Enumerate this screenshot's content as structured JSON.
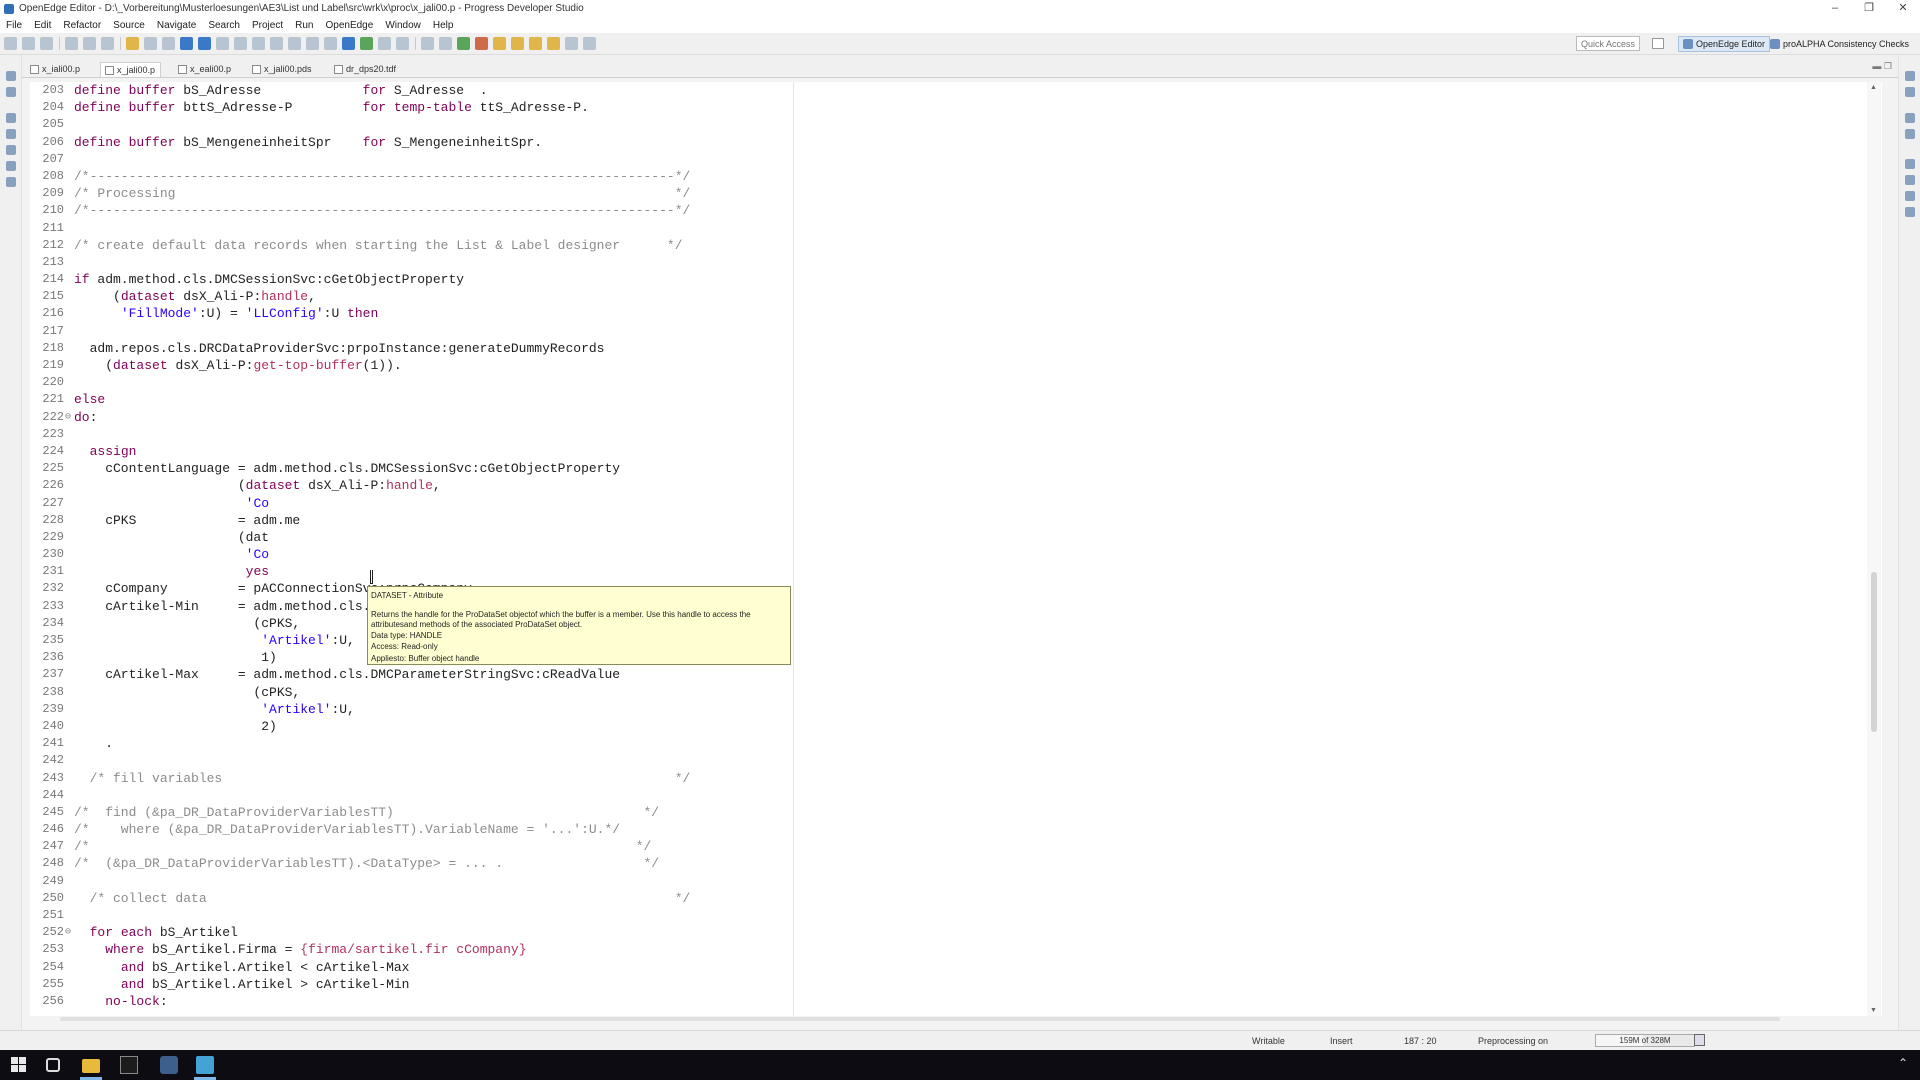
{
  "window": {
    "title": "OpenEdge Editor - D:\\_Vorbereitung\\Musterloesungen\\AE3\\List und Label\\src\\wrk\\x\\proc\\x_jali00.p - Progress Developer Studio",
    "controls": [
      "–",
      "❐",
      "✕"
    ]
  },
  "menu": [
    "File",
    "Edit",
    "Refactor",
    "Source",
    "Navigate",
    "Search",
    "Project",
    "Run",
    "OpenEdge",
    "Window",
    "Help"
  ],
  "toolbar": {
    "quick_access_placeholder": "Quick Access",
    "perspectives": [
      "OpenEdge Editor",
      "proALPHA Consistency Checks"
    ]
  },
  "tabs": [
    {
      "label": "x_iali00.p"
    },
    {
      "label": "x_jali00.p",
      "active": true
    },
    {
      "label": "x_eali00.p"
    },
    {
      "label": "x_jali00.pds"
    },
    {
      "label": "dr_dps20.tdf"
    }
  ],
  "code": [
    {
      "n": "203",
      "t": [
        [
          "kw",
          "define buffer "
        ],
        [
          "pl",
          "bS_Adresse             "
        ],
        [
          "kw",
          "for "
        ],
        [
          "pl",
          "S_Adresse  ."
        ]
      ]
    },
    {
      "n": "204",
      "t": [
        [
          "kw",
          "define buffer "
        ],
        [
          "pl",
          "bttS_Adresse-P         "
        ],
        [
          "kw",
          "for temp-table "
        ],
        [
          "pl",
          "ttS_Adresse-P."
        ]
      ]
    },
    {
      "n": "205",
      "t": [
        [
          "pl",
          ""
        ]
      ]
    },
    {
      "n": "206",
      "t": [
        [
          "kw",
          "define buffer "
        ],
        [
          "pl",
          "bS_MengeneinheitSpr    "
        ],
        [
          "kw",
          "for "
        ],
        [
          "pl",
          "S_MengeneinheitSpr."
        ]
      ]
    },
    {
      "n": "207",
      "t": [
        [
          "pl",
          ""
        ]
      ]
    },
    {
      "n": "208",
      "t": [
        [
          "cm",
          "/*---------------------------------------------------------------------------*/"
        ]
      ]
    },
    {
      "n": "209",
      "t": [
        [
          "cm",
          "/* Processing                                                                */"
        ]
      ]
    },
    {
      "n": "210",
      "t": [
        [
          "cm",
          "/*---------------------------------------------------------------------------*/"
        ]
      ]
    },
    {
      "n": "211",
      "t": [
        [
          "pl",
          ""
        ]
      ]
    },
    {
      "n": "212",
      "t": [
        [
          "cm",
          "/* create default data records when starting the List & Label designer      */"
        ]
      ]
    },
    {
      "n": "213",
      "t": [
        [
          "pl",
          ""
        ]
      ]
    },
    {
      "n": "214",
      "t": [
        [
          "kw",
          "if "
        ],
        [
          "pl",
          "adm.method.cls.DMCSessionSvc:cGetObjectProperty"
        ]
      ]
    },
    {
      "n": "215",
      "t": [
        [
          "pl",
          "     ("
        ],
        [
          "kw",
          "dataset "
        ],
        [
          "pl",
          "dsX_Ali-P:"
        ],
        [
          "at",
          "handle"
        ],
        [
          "pl",
          ","
        ]
      ]
    },
    {
      "n": "216",
      "t": [
        [
          "pl",
          "      "
        ],
        [
          "st",
          "'FillMode'"
        ],
        [
          "pl",
          ":U) = "
        ],
        [
          "st",
          "'LLConfig'"
        ],
        [
          "pl",
          ":U "
        ],
        [
          "kw",
          "then"
        ]
      ]
    },
    {
      "n": "217",
      "t": [
        [
          "pl",
          ""
        ]
      ]
    },
    {
      "n": "218",
      "t": [
        [
          "pl",
          "  adm.repos.cls.DRCDataProviderSvc:prpoInstance:generateDummyRecords"
        ]
      ]
    },
    {
      "n": "219",
      "t": [
        [
          "pl",
          "    ("
        ],
        [
          "kw",
          "dataset "
        ],
        [
          "pl",
          "dsX_Ali-P:"
        ],
        [
          "at",
          "get-top-buffer"
        ],
        [
          "pl",
          "(1))."
        ]
      ]
    },
    {
      "n": "220",
      "t": [
        [
          "pl",
          ""
        ]
      ]
    },
    {
      "n": "221",
      "t": [
        [
          "kw",
          "else"
        ]
      ]
    },
    {
      "n": "222",
      "f": "⊖",
      "t": [
        [
          "kw",
          "do"
        ],
        [
          "pl",
          ":"
        ]
      ]
    },
    {
      "n": "223",
      "t": [
        [
          "pl",
          ""
        ]
      ]
    },
    {
      "n": "224",
      "t": [
        [
          "pl",
          "  "
        ],
        [
          "kw",
          "assign"
        ]
      ]
    },
    {
      "n": "225",
      "t": [
        [
          "pl",
          "    cContentLanguage = adm.method.cls.DMCSessionSvc:cGetObjectProperty"
        ]
      ]
    },
    {
      "n": "226",
      "t": [
        [
          "pl",
          "                     ("
        ],
        [
          "kw",
          "dataset "
        ],
        [
          "pl",
          "dsX_Ali-P:"
        ],
        [
          "at",
          "handle"
        ],
        [
          "pl",
          ","
        ]
      ]
    },
    {
      "n": "227",
      "t": [
        [
          "pl",
          "                      "
        ],
        [
          "st",
          "'Co"
        ]
      ]
    },
    {
      "n": "228",
      "t": [
        [
          "pl",
          "    cPKS             = adm.me"
        ]
      ]
    },
    {
      "n": "229",
      "t": [
        [
          "pl",
          "                     (dat"
        ]
      ]
    },
    {
      "n": "230",
      "t": [
        [
          "pl",
          "                      "
        ],
        [
          "st",
          "'Co"
        ]
      ]
    },
    {
      "n": "231",
      "t": [
        [
          "pl",
          "                      "
        ],
        [
          "kw",
          "yes"
        ]
      ]
    },
    {
      "n": "232",
      "t": [
        [
          "pl",
          "    cCompany         = pACConnectionSvc:prpcCompany"
        ]
      ]
    },
    {
      "n": "233",
      "t": [
        [
          "pl",
          "    cArtikel-Min     = adm.method.cls.DMCParameterStringSvc:cReadValue"
        ]
      ]
    },
    {
      "n": "234",
      "t": [
        [
          "pl",
          "                       (cPKS,"
        ]
      ]
    },
    {
      "n": "235",
      "t": [
        [
          "pl",
          "                        "
        ],
        [
          "st",
          "'Artikel'"
        ],
        [
          "pl",
          ":U,"
        ]
      ]
    },
    {
      "n": "236",
      "t": [
        [
          "pl",
          "                        1)"
        ]
      ]
    },
    {
      "n": "237",
      "t": [
        [
          "pl",
          "    cArtikel-Max     = adm.method.cls.DMCParameterStringSvc:cReadValue"
        ]
      ]
    },
    {
      "n": "238",
      "t": [
        [
          "pl",
          "                       (cPKS,"
        ]
      ]
    },
    {
      "n": "239",
      "t": [
        [
          "pl",
          "                        "
        ],
        [
          "st",
          "'Artikel'"
        ],
        [
          "pl",
          ":U,"
        ]
      ]
    },
    {
      "n": "240",
      "t": [
        [
          "pl",
          "                        2)"
        ]
      ]
    },
    {
      "n": "241",
      "t": [
        [
          "pl",
          "    ."
        ]
      ]
    },
    {
      "n": "242",
      "t": [
        [
          "pl",
          ""
        ]
      ]
    },
    {
      "n": "243",
      "t": [
        [
          "cm",
          "  /* fill variables                                                          */"
        ]
      ]
    },
    {
      "n": "244",
      "t": [
        [
          "pl",
          ""
        ]
      ]
    },
    {
      "n": "245",
      "t": [
        [
          "cm",
          "/*  find (&pa_DR_DataProviderVariablesTT)                                */"
        ]
      ]
    },
    {
      "n": "246",
      "t": [
        [
          "cm",
          "/*    where (&pa_DR_DataProviderVariablesTT).VariableName = '...':U.*/"
        ]
      ]
    },
    {
      "n": "247",
      "t": [
        [
          "cm",
          "/*                                                                      */"
        ]
      ]
    },
    {
      "n": "248",
      "t": [
        [
          "cm",
          "/*  (&pa_DR_DataProviderVariablesTT).<DataType> = ... .                  */"
        ]
      ]
    },
    {
      "n": "249",
      "t": [
        [
          "pl",
          ""
        ]
      ]
    },
    {
      "n": "250",
      "t": [
        [
          "cm",
          "  /* collect data                                                            */"
        ]
      ]
    },
    {
      "n": "251",
      "t": [
        [
          "pl",
          ""
        ]
      ]
    },
    {
      "n": "252",
      "f": "⊖",
      "t": [
        [
          "pl",
          "  "
        ],
        [
          "kw",
          "for each "
        ],
        [
          "pl",
          "bS_Artikel"
        ]
      ]
    },
    {
      "n": "253",
      "t": [
        [
          "pl",
          "    "
        ],
        [
          "kw",
          "where "
        ],
        [
          "pl",
          "bS_Artikel.Firma = "
        ],
        [
          "at",
          "{firma/sartikel.fir cCompany}"
        ]
      ]
    },
    {
      "n": "254",
      "t": [
        [
          "pl",
          "      "
        ],
        [
          "kw",
          "and "
        ],
        [
          "pl",
          "bS_Artikel.Artikel < cArtikel-Max"
        ]
      ]
    },
    {
      "n": "255",
      "t": [
        [
          "pl",
          "      "
        ],
        [
          "kw",
          "and "
        ],
        [
          "pl",
          "bS_Artikel.Artikel > cArtikel-Min"
        ]
      ]
    },
    {
      "n": "256",
      "t": [
        [
          "pl",
          "    "
        ],
        [
          "kw",
          "no-lock"
        ],
        [
          "pl",
          ":"
        ]
      ]
    }
  ],
  "tooltip": {
    "title": "DATASET - Attribute",
    "description": "Returns the handle for the ProDataSet objectof which the buffer is a member. Use this handle to access the attributesand methods of the associated ProDataSet object.",
    "rows": [
      "Data type: HANDLE",
      "Access: Read-only",
      "Appliesto: Buffer object handle"
    ]
  },
  "status": {
    "mode": "Writable",
    "insert": "Insert",
    "position": "187 : 20",
    "preprocessing": "Preprocessing on",
    "heap": "159M of 328M",
    "heap_fraction": 0.48
  },
  "colors": {
    "keyword": "#7f0055",
    "comment": "#8c8c8c",
    "string": "#2a00ff",
    "attribute": "#b03060",
    "tooltip_bg": "#ffffd2"
  }
}
